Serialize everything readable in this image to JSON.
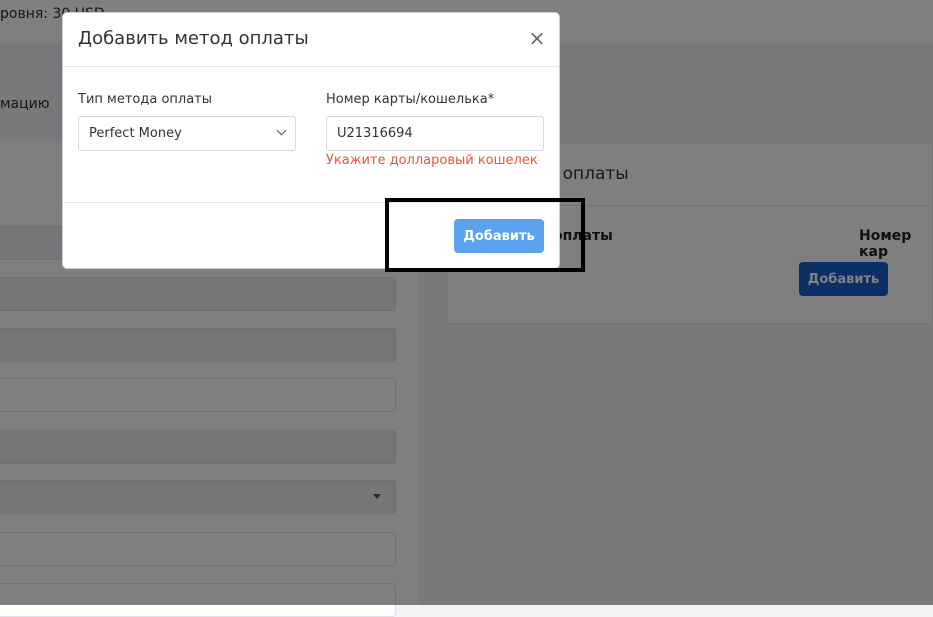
{
  "background": {
    "topbar_text": "ровня: 30 USD",
    "subnav_item": "мацию",
    "payment_methods_card": {
      "title": "ды оплаты",
      "col_type": "оплаты",
      "col_number": "Номер кар",
      "add_button": "Добавить"
    }
  },
  "modal": {
    "title": "Добавить метод оплаты",
    "close_symbol": "×",
    "method_type_label": "Тип метода оплаты",
    "method_type_value": "Perfect Money",
    "card_number_label": "Номер карты/кошелька*",
    "card_number_value": "U21316694",
    "error_message": "Укажите долларовый кошелек",
    "add_button": "Добавить"
  },
  "colors": {
    "error": "#e8543c",
    "primary_button": "#1a5fd0",
    "modal_button": "#5ba3ef"
  }
}
